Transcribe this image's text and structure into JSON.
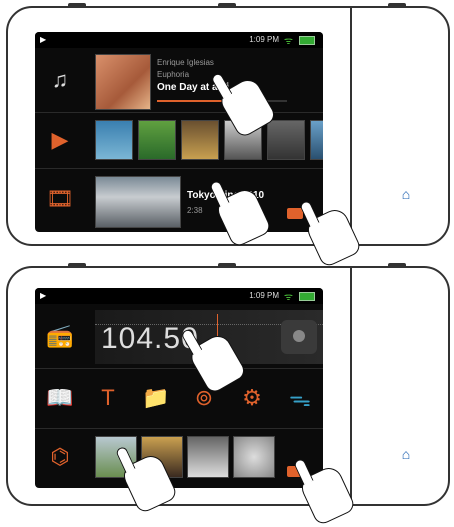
{
  "device1": {
    "status": {
      "time": "1:09 PM"
    },
    "music": {
      "artist": "Enrique Iglesias",
      "album": "Euphoria",
      "title": "One Day at a Ti"
    },
    "video": {
      "title": "Tokyo Line 2010",
      "duration": "2:38"
    }
  },
  "device2": {
    "status": {
      "time": "1:09 PM"
    },
    "radio": {
      "frequency": "104.50"
    }
  },
  "icons": {
    "music": "music-note-icon",
    "video": "video-play-icon",
    "film": "film-strip-icon",
    "radio": "radio-icon",
    "home": "home-icon"
  }
}
